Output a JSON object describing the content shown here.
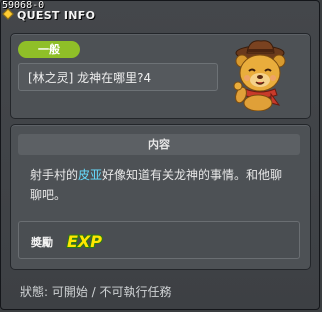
{
  "window": {
    "quest_id": "59068-0",
    "title": "QUEST INFO"
  },
  "quest": {
    "category_tag": "一般",
    "name": "[林之灵] 龙神在哪里?4"
  },
  "content": {
    "header": "内容",
    "description_before": "射手村的",
    "npc_name": "皮亚",
    "description_after": "好像知道有关龙神的事情。和他聊聊吧。"
  },
  "reward": {
    "label": "奬勵",
    "icon_text": "EXP"
  },
  "status": {
    "text": "狀態: 可開始 / 不可執行任務"
  },
  "colors": {
    "tag_green": "#8fbf28",
    "highlight_cyan": "#66ddff",
    "exp_yellow": "#ffe600",
    "exp_green": "#2fbf2f"
  }
}
